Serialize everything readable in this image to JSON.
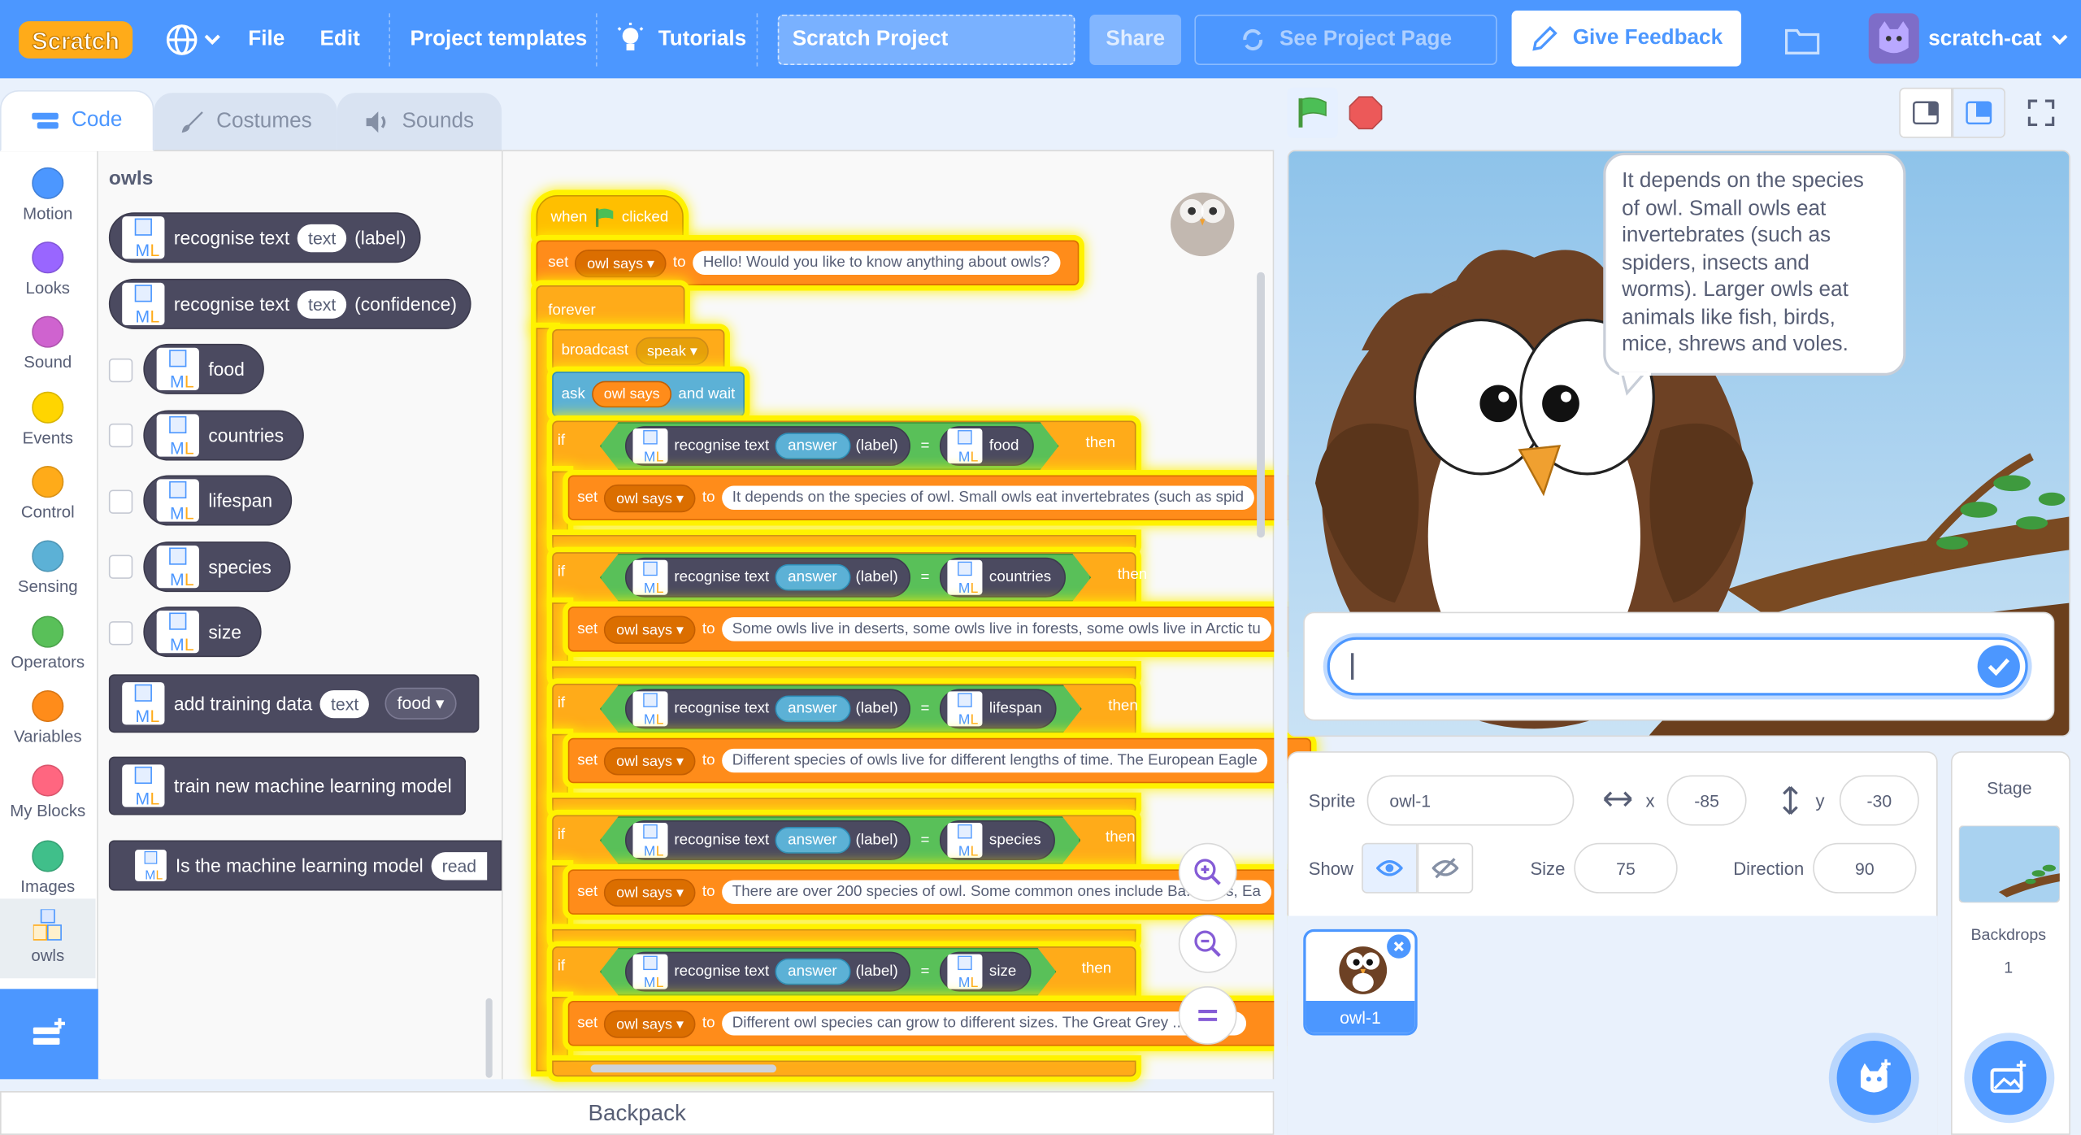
{
  "menu": {
    "logo": "Scratch",
    "file": "File",
    "edit": "Edit",
    "templates": "Project templates",
    "tutorials": "Tutorials",
    "project_title": "Scratch Project",
    "share": "Share",
    "see_project_page": "See Project Page",
    "feedback": "Give Feedback",
    "username": "scratch-cat"
  },
  "tabs": [
    {
      "label": "Code",
      "icon": "code-icon",
      "active": true
    },
    {
      "label": "Costumes",
      "icon": "brush-icon",
      "active": false
    },
    {
      "label": "Sounds",
      "icon": "speaker-icon",
      "active": false
    }
  ],
  "categories": [
    {
      "label": "Motion",
      "color": "#4c97ff"
    },
    {
      "label": "Looks",
      "color": "#9966ff"
    },
    {
      "label": "Sound",
      "color": "#cf63cf"
    },
    {
      "label": "Events",
      "color": "#ffd500"
    },
    {
      "label": "Control",
      "color": "#ffab19"
    },
    {
      "label": "Sensing",
      "color": "#5cb1d6"
    },
    {
      "label": "Operators",
      "color": "#59c059"
    },
    {
      "label": "Variables",
      "color": "#ff8c1a"
    },
    {
      "label": "My Blocks",
      "color": "#ff6680"
    },
    {
      "label": "Images",
      "color": "#40bf8a"
    },
    {
      "label": "owls",
      "color": "#4b4a60"
    }
  ],
  "flyout": {
    "title": "owls",
    "recognise_label": "recognise text",
    "recognise_confidence": "recognise text",
    "text_slot": "text",
    "label_suffix": "(label)",
    "confidence_suffix": "(confidence)",
    "labels": [
      "food",
      "countries",
      "lifespan",
      "species",
      "size"
    ],
    "add_training": "add training data",
    "add_training_text": "text",
    "add_training_label": "food",
    "train_model": "train new machine learning model",
    "is_model": "Is the machine learning model",
    "is_model_more": "read"
  },
  "script": {
    "when": "when",
    "clicked": "clicked",
    "set": "set",
    "owl_says": "owl says",
    "to": "to",
    "hello": "Hello! Would you like to know anything about owls?",
    "forever": "forever",
    "broadcast": "broadcast",
    "speak": "speak",
    "ask": "ask",
    "and_wait": "and wait",
    "if": "if",
    "then": "then",
    "recognise": "recognise text",
    "answer": "answer",
    "label": "(label)",
    "eq": "=",
    "branches": [
      {
        "label": "food",
        "reply": "It depends on the species of owl. Small owls eat invertebrates (such as spid"
      },
      {
        "label": "countries",
        "reply": "Some owls live in deserts, some owls live in forests, some owls live in Arctic tu"
      },
      {
        "label": "lifespan",
        "reply": "Different species of owls live for different lengths of time. The European Eagle"
      },
      {
        "label": "species",
        "reply": "There are over 200 species of owl. Some common ones include Ba... owls, Ea"
      },
      {
        "label": "size",
        "reply": "Different owl species can grow to different sizes. The Great Grey ... n grow"
      }
    ]
  },
  "backpack": "Backpack",
  "stage": {
    "bubble": "It depends on the species of owl. Small owls eat invertebrates (such as spiders, insects and worms). Larger owls eat animals like fish, birds, mice, shrews and voles.",
    "ask_value": ""
  },
  "sprite_info": {
    "sprite_label": "Sprite",
    "sprite_name": "owl-1",
    "x_label": "x",
    "x": "-85",
    "y_label": "y",
    "y": "-30",
    "show_label": "Show",
    "size_label": "Size",
    "size": "75",
    "direction_label": "Direction",
    "direction": "90"
  },
  "sprites": [
    {
      "name": "owl-1"
    }
  ],
  "stage_pane": {
    "title": "Stage",
    "backdrops_label": "Backdrops",
    "backdrops_count": "1"
  },
  "colors": {
    "accent": "#4c97ff",
    "extension": "#4b4a60",
    "highlight": "#fff200"
  }
}
